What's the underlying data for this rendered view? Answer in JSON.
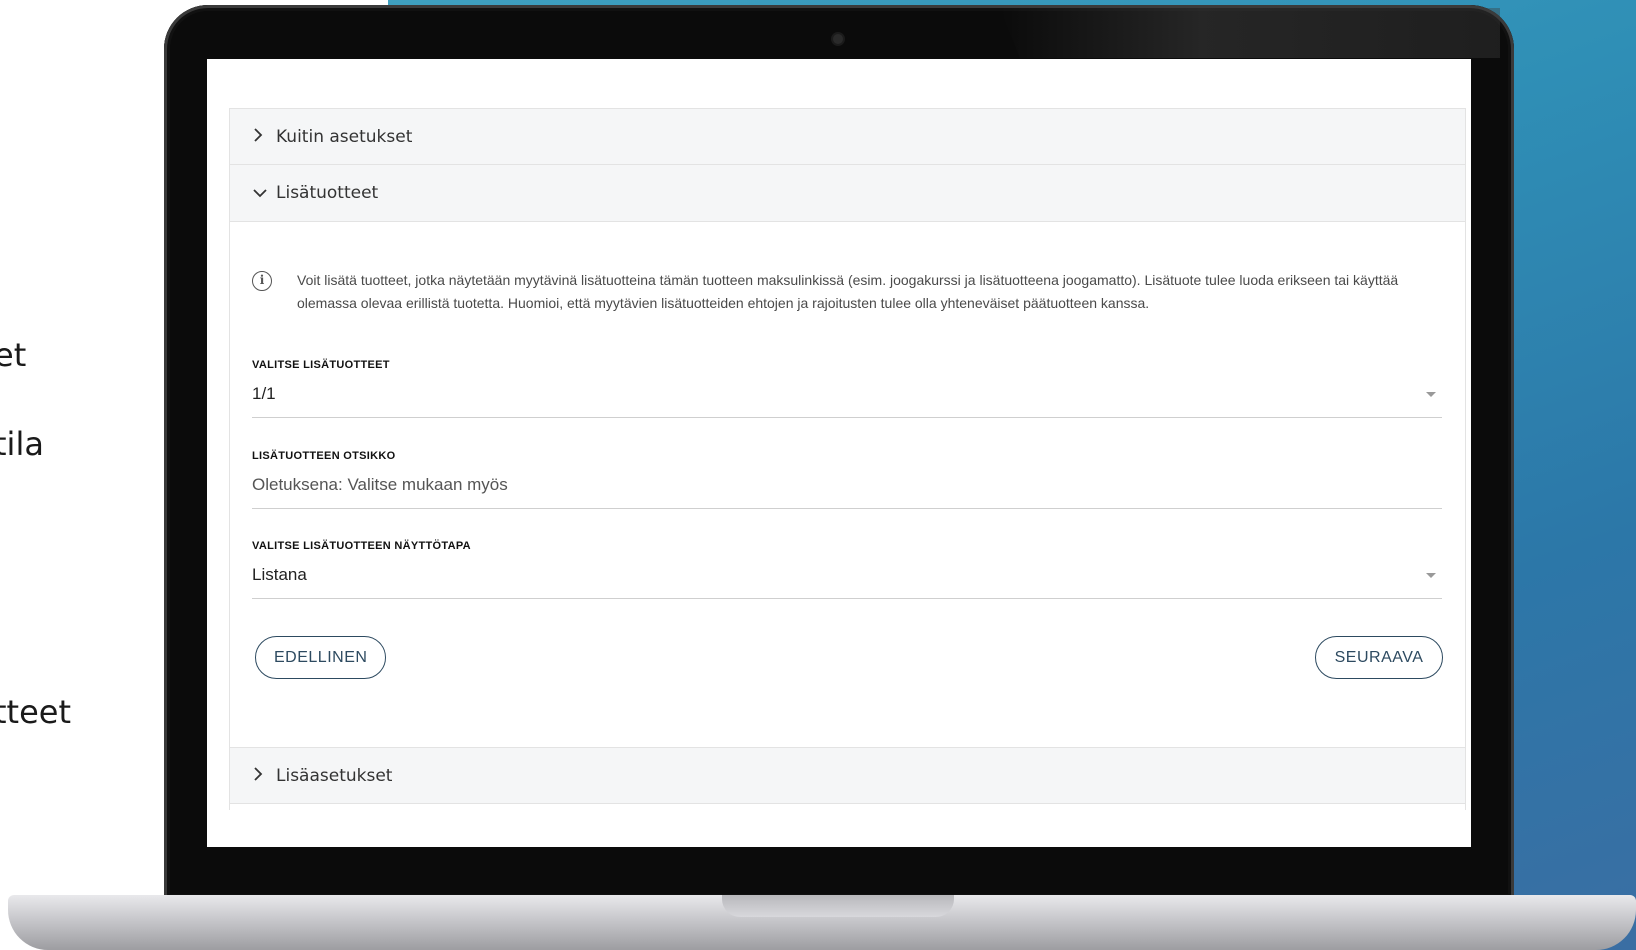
{
  "side_texts": [
    "et",
    "tila",
    "tteet"
  ],
  "accordion": {
    "receipt_settings": "Kuitin asetukset",
    "add_ons": "Lisätuotteet",
    "more_settings": "Lisäasetukset"
  },
  "info": {
    "icon": "info-icon",
    "text": "Voit lisätä tuotteet, jotka näytetään myytävinä lisätuotteina tämän tuotteen maksulinkissä (esim. joogakurssi ja lisätuotteena joogamatto). Lisätuote tulee luoda erikseen tai käyttää olemassa olevaa erillistä tuotetta. Huomioi, että myytävien lisätuotteiden ehtojen ja rajoitusten tulee olla yhteneväiset päätuotteen kanssa."
  },
  "fields": {
    "select_addons": {
      "label": "VALITSE LISÄTUOTTEET",
      "value": "1/1"
    },
    "addon_title": {
      "label": "LISÄTUOTTEEN OTSIKKO",
      "placeholder": "Oletuksena: Valitse mukaan myös"
    },
    "display_mode": {
      "label": "VALITSE LISÄTUOTTEEN NÄYTTÖTAPA",
      "value": "Listana"
    }
  },
  "buttons": {
    "previous": "EDELLINEN",
    "next": "SEURAAVA"
  },
  "colors": {
    "button_border": "#2d4a60",
    "background_accent": "#2f8fb6"
  }
}
